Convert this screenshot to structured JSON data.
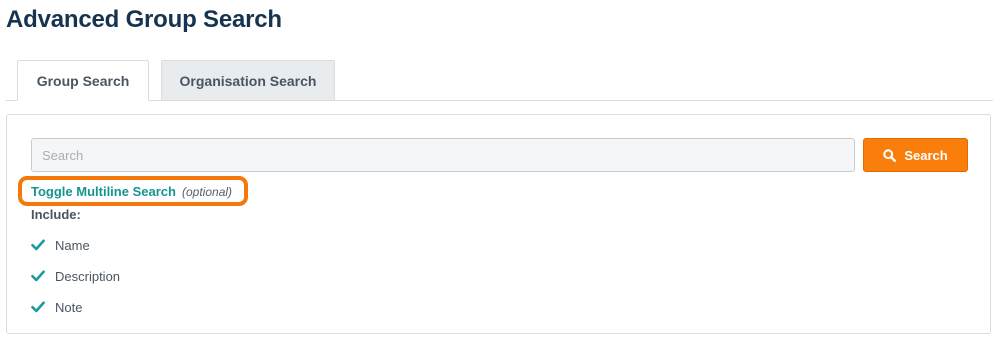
{
  "page": {
    "title": "Advanced Group Search"
  },
  "tabs": [
    {
      "label": "Group Search",
      "active": true
    },
    {
      "label": "Organisation Search",
      "active": false
    }
  ],
  "search": {
    "placeholder": "Search",
    "value": "",
    "button_label": "Search",
    "button_icon": "search-icon"
  },
  "toggle": {
    "link_label": "Toggle Multiline Search",
    "optional_label": "(optional)"
  },
  "include": {
    "label": "Include:",
    "options": [
      {
        "label": "Name",
        "checked": true
      },
      {
        "label": "Description",
        "checked": true
      },
      {
        "label": "Note",
        "checked": true
      }
    ]
  },
  "colors": {
    "title": "#16344f",
    "accent_orange": "#f97e0c",
    "link_teal": "#16958f",
    "check_teal": "#1a9aa0"
  }
}
